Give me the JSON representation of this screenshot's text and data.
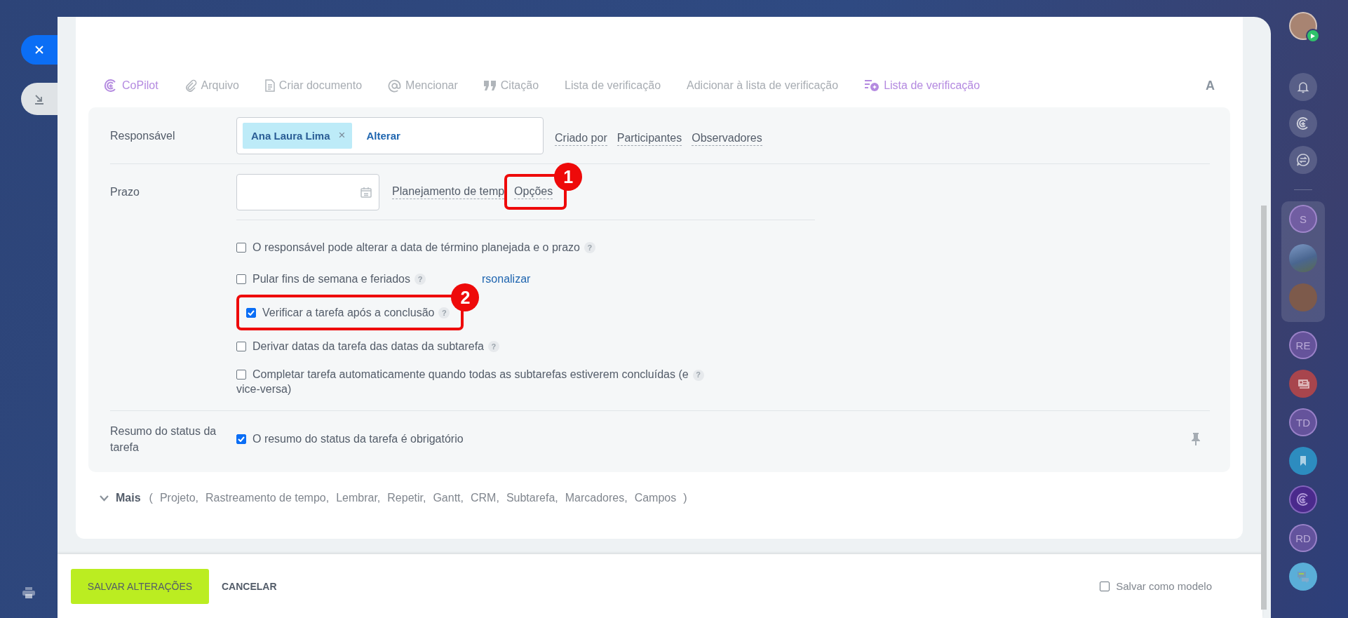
{
  "toolbar": {
    "items": [
      {
        "kind": "copilot",
        "label": "CoPilot",
        "accent": true
      },
      {
        "kind": "file",
        "label": "Arquivo",
        "accent": false
      },
      {
        "kind": "document",
        "label": "Criar documento",
        "accent": false
      },
      {
        "kind": "mention",
        "label": "Mencionar",
        "accent": false
      },
      {
        "kind": "quote",
        "label": "Citação",
        "accent": false
      },
      {
        "kind": "text",
        "label": "Lista de verificação",
        "accent": false
      },
      {
        "kind": "text",
        "label": "Adicionar à lista de verificação",
        "accent": false
      },
      {
        "kind": "checklist",
        "label": "Lista de verificação",
        "accent": true
      }
    ],
    "format": "A"
  },
  "responsible": {
    "label": "Responsável",
    "chip": "Ana Laura Lima",
    "remove": "×",
    "change": "Alterar",
    "links": [
      "Criado por",
      "Participantes",
      "Observadores"
    ]
  },
  "deadline": {
    "label": "Prazo",
    "planning": "Planejamento de temp",
    "options": {
      "label": "Opções",
      "callout": "1"
    }
  },
  "checkboxes": [
    {
      "label": "O responsável pode alterar a data de término planejada e o prazo",
      "checked": false,
      "help": "?"
    },
    {
      "label": "Pular fins de semana e feriados",
      "checked": false,
      "help": "?",
      "link": "rsonalizar"
    },
    {
      "label": "Verificar a tarefa após a conclusão",
      "checked": true,
      "help": "?",
      "callout": "2"
    },
    {
      "label": "Derivar datas da tarefa das datas da subtarefa",
      "checked": false,
      "help": "?"
    },
    {
      "label": "Completar tarefa automaticamente quando todas as subtarefas estiverem concluídas (e",
      "label_2": "vice-versa)",
      "checked": false,
      "help": "?"
    }
  ],
  "status_summary": {
    "label": "Resumo do status da tarefa",
    "text": "O resumo do status da tarefa é obrigatório",
    "checked": true
  },
  "more": {
    "label": "Mais",
    "open": "(",
    "close": ")",
    "items": [
      "Projeto,",
      "Rastreamento de tempo,",
      "Lembrar,",
      "Repetir,",
      "Gantt,",
      "CRM,",
      "Subtarefa,",
      "Marcadores,",
      "Campos"
    ]
  },
  "footer": {
    "save": "SALVAR ALTERAÇÕES",
    "cancel": "CANCELAR",
    "template": {
      "label": "Salvar como modelo",
      "checked": false
    }
  },
  "right_sidebar": {
    "top": [
      {
        "kind": "user"
      },
      {
        "kind": "bell"
      },
      {
        "kind": "copilot"
      },
      {
        "kind": "chat-swap"
      }
    ],
    "pinned": [
      {
        "kind": "initials",
        "text": "S"
      },
      {
        "kind": "photo"
      },
      {
        "kind": "avatar"
      }
    ],
    "bottom": [
      {
        "kind": "initials",
        "text": "RE"
      },
      {
        "kind": "contact-card"
      },
      {
        "kind": "initials",
        "text": "TD"
      },
      {
        "kind": "bookmark"
      },
      {
        "kind": "copilot-dark"
      },
      {
        "kind": "initials",
        "text": "RD"
      },
      {
        "kind": "chat"
      }
    ]
  }
}
